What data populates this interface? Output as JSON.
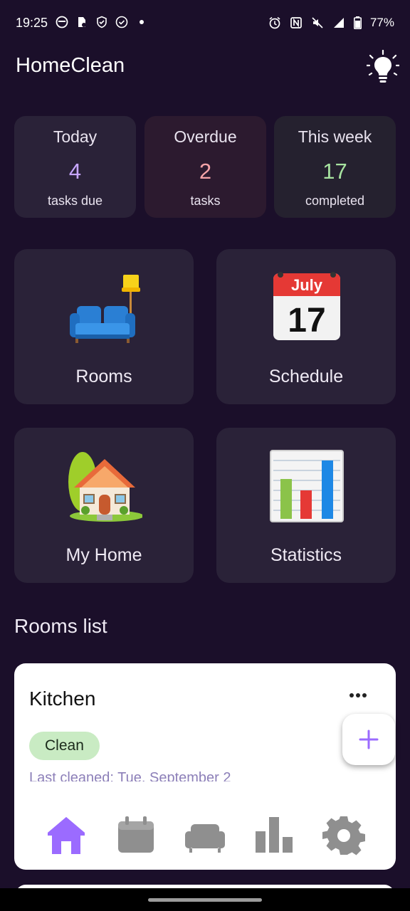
{
  "status_bar": {
    "time": "19:25",
    "battery": "77%"
  },
  "app": {
    "title": "HomeClean"
  },
  "summary": {
    "today": {
      "label": "Today",
      "value": "4",
      "sub": "tasks due",
      "color": "#c7a6ff"
    },
    "overdue": {
      "label": "Overdue",
      "value": "2",
      "sub": "tasks",
      "color": "#f4a3a8"
    },
    "week": {
      "label": "This week",
      "value": "17",
      "sub": "completed",
      "color": "#a7e3a0"
    }
  },
  "tiles": {
    "rooms": "Rooms",
    "schedule": "Schedule",
    "home": "My Home",
    "stats": "Statistics",
    "calendar_month": "July",
    "calendar_day": "17"
  },
  "section": {
    "rooms_list": "Rooms list"
  },
  "room": {
    "name": "Kitchen",
    "badge": "Clean",
    "last_cleaned": "Last cleaned: Tue, September 2"
  },
  "nav": {
    "items": [
      "home-icon",
      "calendar-icon",
      "sofa-icon",
      "bar-chart-icon",
      "gear-icon"
    ],
    "active_color": "#9b6bff",
    "inactive_color": "#8f8f8f"
  }
}
